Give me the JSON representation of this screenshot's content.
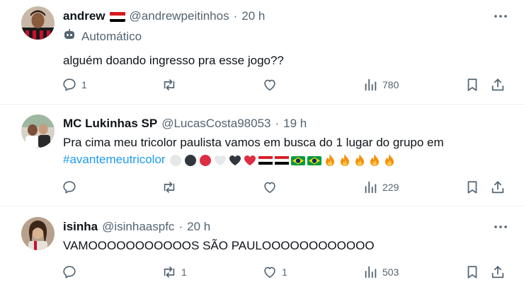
{
  "posts": [
    {
      "name": "andrew",
      "handle": "@andrewpeitinhos",
      "separator": "·",
      "time": "20 h",
      "automated_label": "Automático",
      "text": "alguém doando ingresso pra esse jogo??",
      "actions": {
        "reply": "1",
        "repost": "",
        "like": "",
        "views": "780"
      }
    },
    {
      "name": "MC Lukinhas SP",
      "handle": "@LucasCosta98053",
      "separator": "·",
      "time": "19 h",
      "text_line1": "Pra cima meu tricolor paulista vamos em busca do 1 lugar do grupo em",
      "hashtag": "#avantemeutricolor",
      "emoji_names": [
        "white-circle-emoji",
        "black-circle-emoji",
        "red-circle-emoji",
        "white-heart-emoji",
        "black-heart-emoji",
        "red-heart-emoji",
        "spfc-flag-emoji",
        "spfc-flag-emoji",
        "brazil-flag-emoji",
        "brazil-flag-emoji",
        "fire-emoji",
        "fire-emoji",
        "fire-emoji",
        "fire-emoji",
        "fire-emoji"
      ],
      "actions": {
        "reply": "",
        "repost": "",
        "like": "",
        "views": "229"
      }
    },
    {
      "name": "isinha",
      "handle": "@isinhaaspfc",
      "separator": "·",
      "time": "20 h",
      "text": "VAMOOOOOOOOOOOS SÃO PAULOOOOOOOOOOOO",
      "actions": {
        "reply": "",
        "repost": "1",
        "like": "1",
        "views": "503"
      }
    }
  ],
  "colors": {
    "text": "#0f1419",
    "secondary": "#536471",
    "link": "#1d9bf0",
    "divider": "#eff3f4"
  },
  "icons": [
    "more-icon",
    "bot-icon",
    "reply-icon",
    "repost-icon",
    "like-icon",
    "views-icon",
    "bookmark-icon",
    "share-icon"
  ]
}
